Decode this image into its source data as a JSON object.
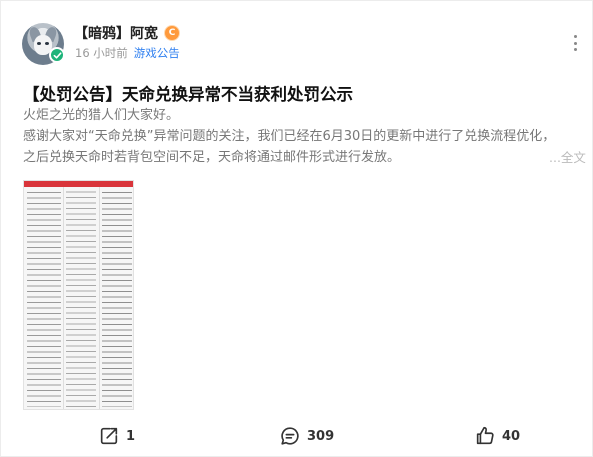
{
  "author": {
    "name": "【暗鸦】阿宽",
    "level_badge": "C",
    "time": "16 小时前",
    "board": "游戏公告"
  },
  "post": {
    "title": "【处罚公告】天命兑换异常不当获利处罚公示",
    "body_lines": [
      "火炬之光的猎人们大家好。",
      "感谢大家对“天命兑换”异常问题的关注，我们已经在6月30日的更新中进行了兑换流程优化，",
      "之后兑换天命时若背包空间不足，天命将通过邮件形式进行发放。"
    ],
    "expand_label": "...全文"
  },
  "actions": {
    "share_count": "1",
    "comment_count": "309",
    "like_count": "40"
  },
  "icons": {
    "verified": "check-icon",
    "more": "more-vertical-icon",
    "share": "share-icon",
    "comment": "comment-icon",
    "like": "thumbs-up-icon"
  },
  "colors": {
    "accent_link": "#2e7ff0",
    "verified_green": "#1db47a",
    "badge_orange": "#ff9a3c",
    "table_header_red": "#d9343a"
  }
}
